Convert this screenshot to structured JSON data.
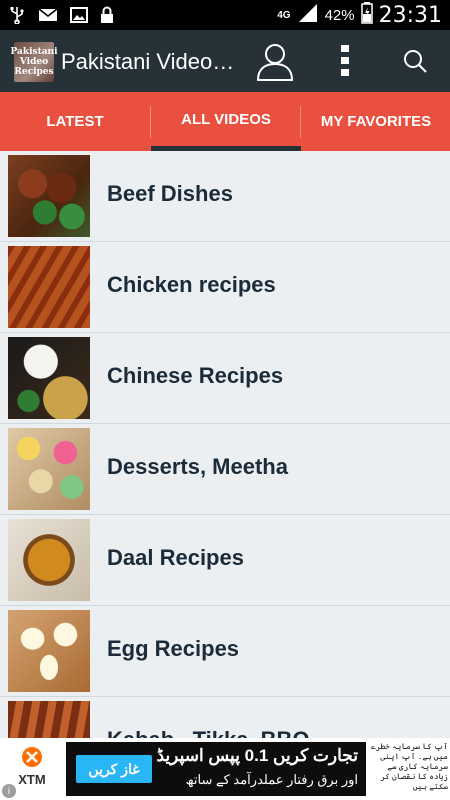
{
  "statusbar": {
    "network": "4G",
    "battery": "42%",
    "time": "23:31",
    "icons": [
      "usb-icon",
      "mail-icon",
      "image-icon",
      "lock-icon"
    ]
  },
  "toolbar": {
    "logo_text": "Pakistani Video Recipes",
    "title": "Pakistani Video…",
    "color": "#263238"
  },
  "tabs": [
    {
      "label": "LATEST",
      "active": false
    },
    {
      "label": "ALL VIDEOS",
      "active": true
    },
    {
      "label": "MY FAVORITES",
      "active": false
    }
  ],
  "accent": "#e9503f",
  "categories": [
    {
      "label": "Beef Dishes",
      "thumb": "beef-dish-photo"
    },
    {
      "label": "Chicken recipes",
      "thumb": "chicken-dish-photo"
    },
    {
      "label": "Chinese Recipes",
      "thumb": "chinese-dish-photo"
    },
    {
      "label": "Desserts, Meetha",
      "thumb": "dessert-photo"
    },
    {
      "label": "Daal Recipes",
      "thumb": "daal-photo"
    },
    {
      "label": "Egg Recipes",
      "thumb": "egg-dish-photo"
    },
    {
      "label": "Kabab , Tikka, BBQ",
      "thumb": "kabab-photo"
    }
  ],
  "ad": {
    "brand": "XTM",
    "headline": "تجارت کریں 0.1 پپس اسپریڈ",
    "subline": "اور برق رفتار عملدرآمد کے ساتھ",
    "button": "غاز کریں",
    "side_text": "آپ کا سرمایہ خطرے میں ہے۔ آپ اپنی سرمایہ کاری سے زیادہ کا نقصان کر سکتے ہیں",
    "info": "i"
  }
}
